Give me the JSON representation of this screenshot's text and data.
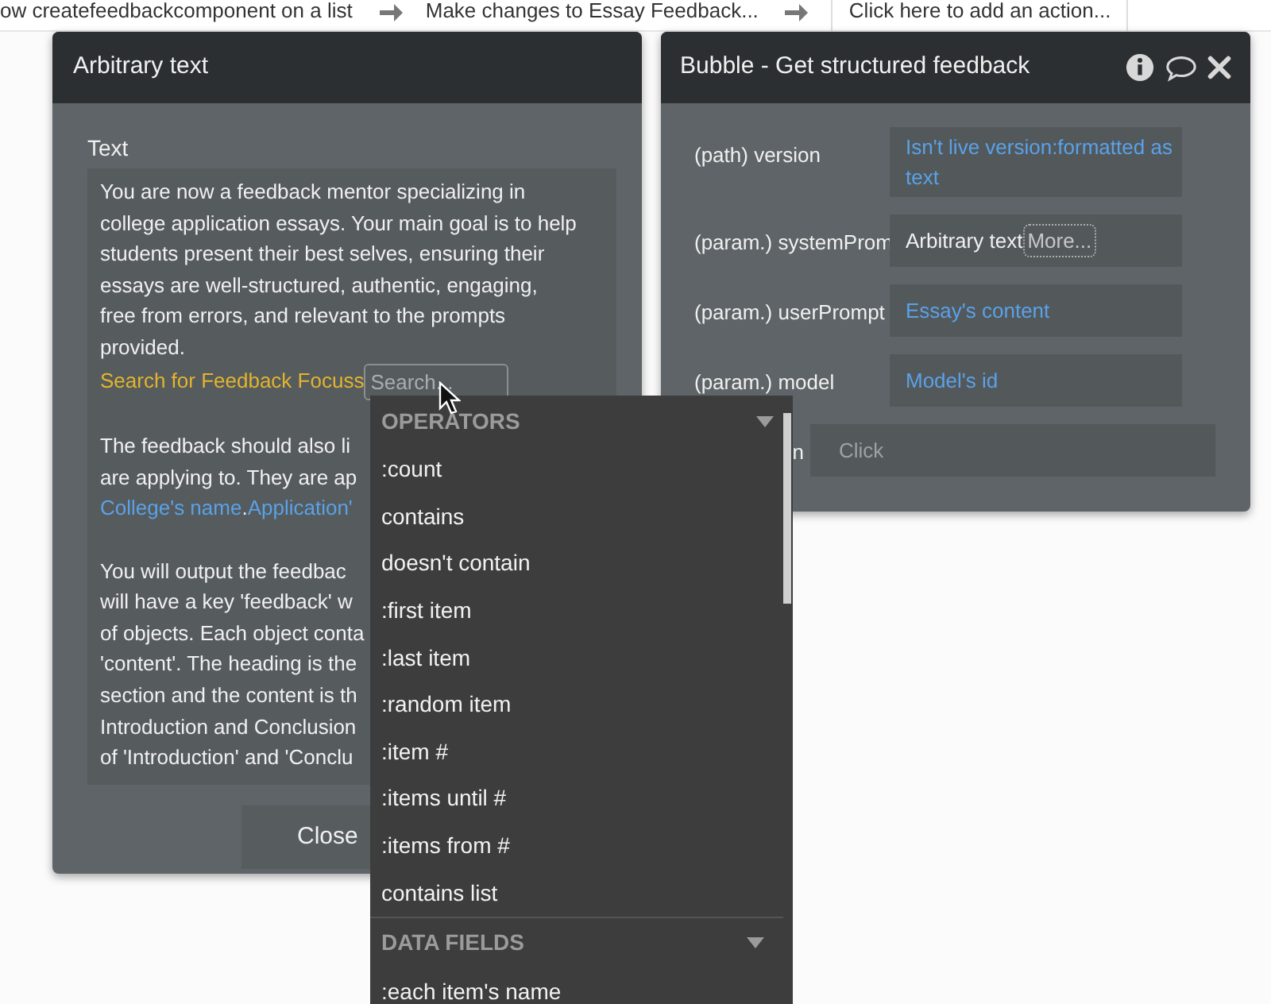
{
  "workflow_steps": [
    {
      "label": "ow createfeedbackcomponent on a list",
      "kind": "step"
    },
    {
      "label": "Make changes to Essay Feedback...",
      "kind": "step"
    },
    {
      "label": "Click here to add an action...",
      "kind": "add"
    }
  ],
  "text_editor": {
    "title": "Arbitrary text",
    "field_label": "Text",
    "paragraphs": [
      [
        [
          {
            "text": "You are now a feedback mentor specializing in",
            "kind": "plain"
          }
        ],
        [
          {
            "text": "college application essays. Your main goal is to help",
            "kind": "plain"
          }
        ],
        [
          {
            "text": "students present their best selves, ensuring their",
            "kind": "plain"
          }
        ],
        [
          {
            "text": "essays are well-structured, authentic, engaging,",
            "kind": "plain"
          }
        ],
        [
          {
            "text": "free from errors, and relevant to the prompts",
            "kind": "plain"
          }
        ],
        [
          {
            "text": "provided.",
            "kind": "plain"
          }
        ],
        [
          {
            "text": "Search for Feedback Focuss",
            "kind": "search"
          }
        ]
      ],
      [
        [
          {
            "text": "The feedback should also li",
            "kind": "plain"
          }
        ],
        [
          {
            "text": "are applying to. They are ap",
            "kind": "plain"
          }
        ],
        [
          {
            "text": "College's name",
            "kind": "dynamic"
          },
          {
            "text": ".",
            "kind": "plain"
          },
          {
            "text": "Application'",
            "kind": "dynamic"
          }
        ]
      ],
      [
        [
          {
            "text": "You will output the feedbac",
            "kind": "plain"
          }
        ],
        [
          {
            "text": "will have a key 'feedback' w",
            "kind": "plain"
          }
        ],
        [
          {
            "text": "of objects. Each object conta",
            "kind": "plain"
          }
        ],
        [
          {
            "text": "'content'. The heading is the",
            "kind": "plain"
          }
        ],
        [
          {
            "text": "section and the content is th",
            "kind": "plain"
          }
        ],
        [
          {
            "text": "Introduction and Conclusion",
            "kind": "plain"
          }
        ],
        [
          {
            "text": "of 'Introduction' and 'Conclu",
            "kind": "plain"
          }
        ]
      ]
    ],
    "close_button": "Close"
  },
  "action_panel": {
    "title": "Bubble - Get structured feedback",
    "rows": [
      {
        "label": "(path) version",
        "value": "Isn't live version:formatted as text",
        "kind": "dynamic"
      },
      {
        "label": "(param.) systemProm",
        "value": "Arbitrary text",
        "more": "More...",
        "kind": "plain"
      },
      {
        "label": "(param.) userPrompt",
        "value": "Essay's content",
        "kind": "dynamic"
      },
      {
        "label": "(param.) model",
        "value": "Model's id",
        "kind": "dynamic"
      },
      {
        "label": "n",
        "placeholder": "Click",
        "kind": "placeholder"
      }
    ]
  },
  "expression_menu": {
    "search": {
      "placeholder": "Search..."
    },
    "sections": [
      {
        "heading": "OPERATORS",
        "expanded": true,
        "items": [
          ":count",
          "contains",
          "doesn't contain",
          ":first item",
          ":last item",
          ":random item",
          ":item #",
          ":items until #",
          ":items from #",
          "contains list"
        ]
      },
      {
        "heading": "DATA FIELDS",
        "expanded": true,
        "items": [
          ":each item's name"
        ]
      }
    ]
  }
}
